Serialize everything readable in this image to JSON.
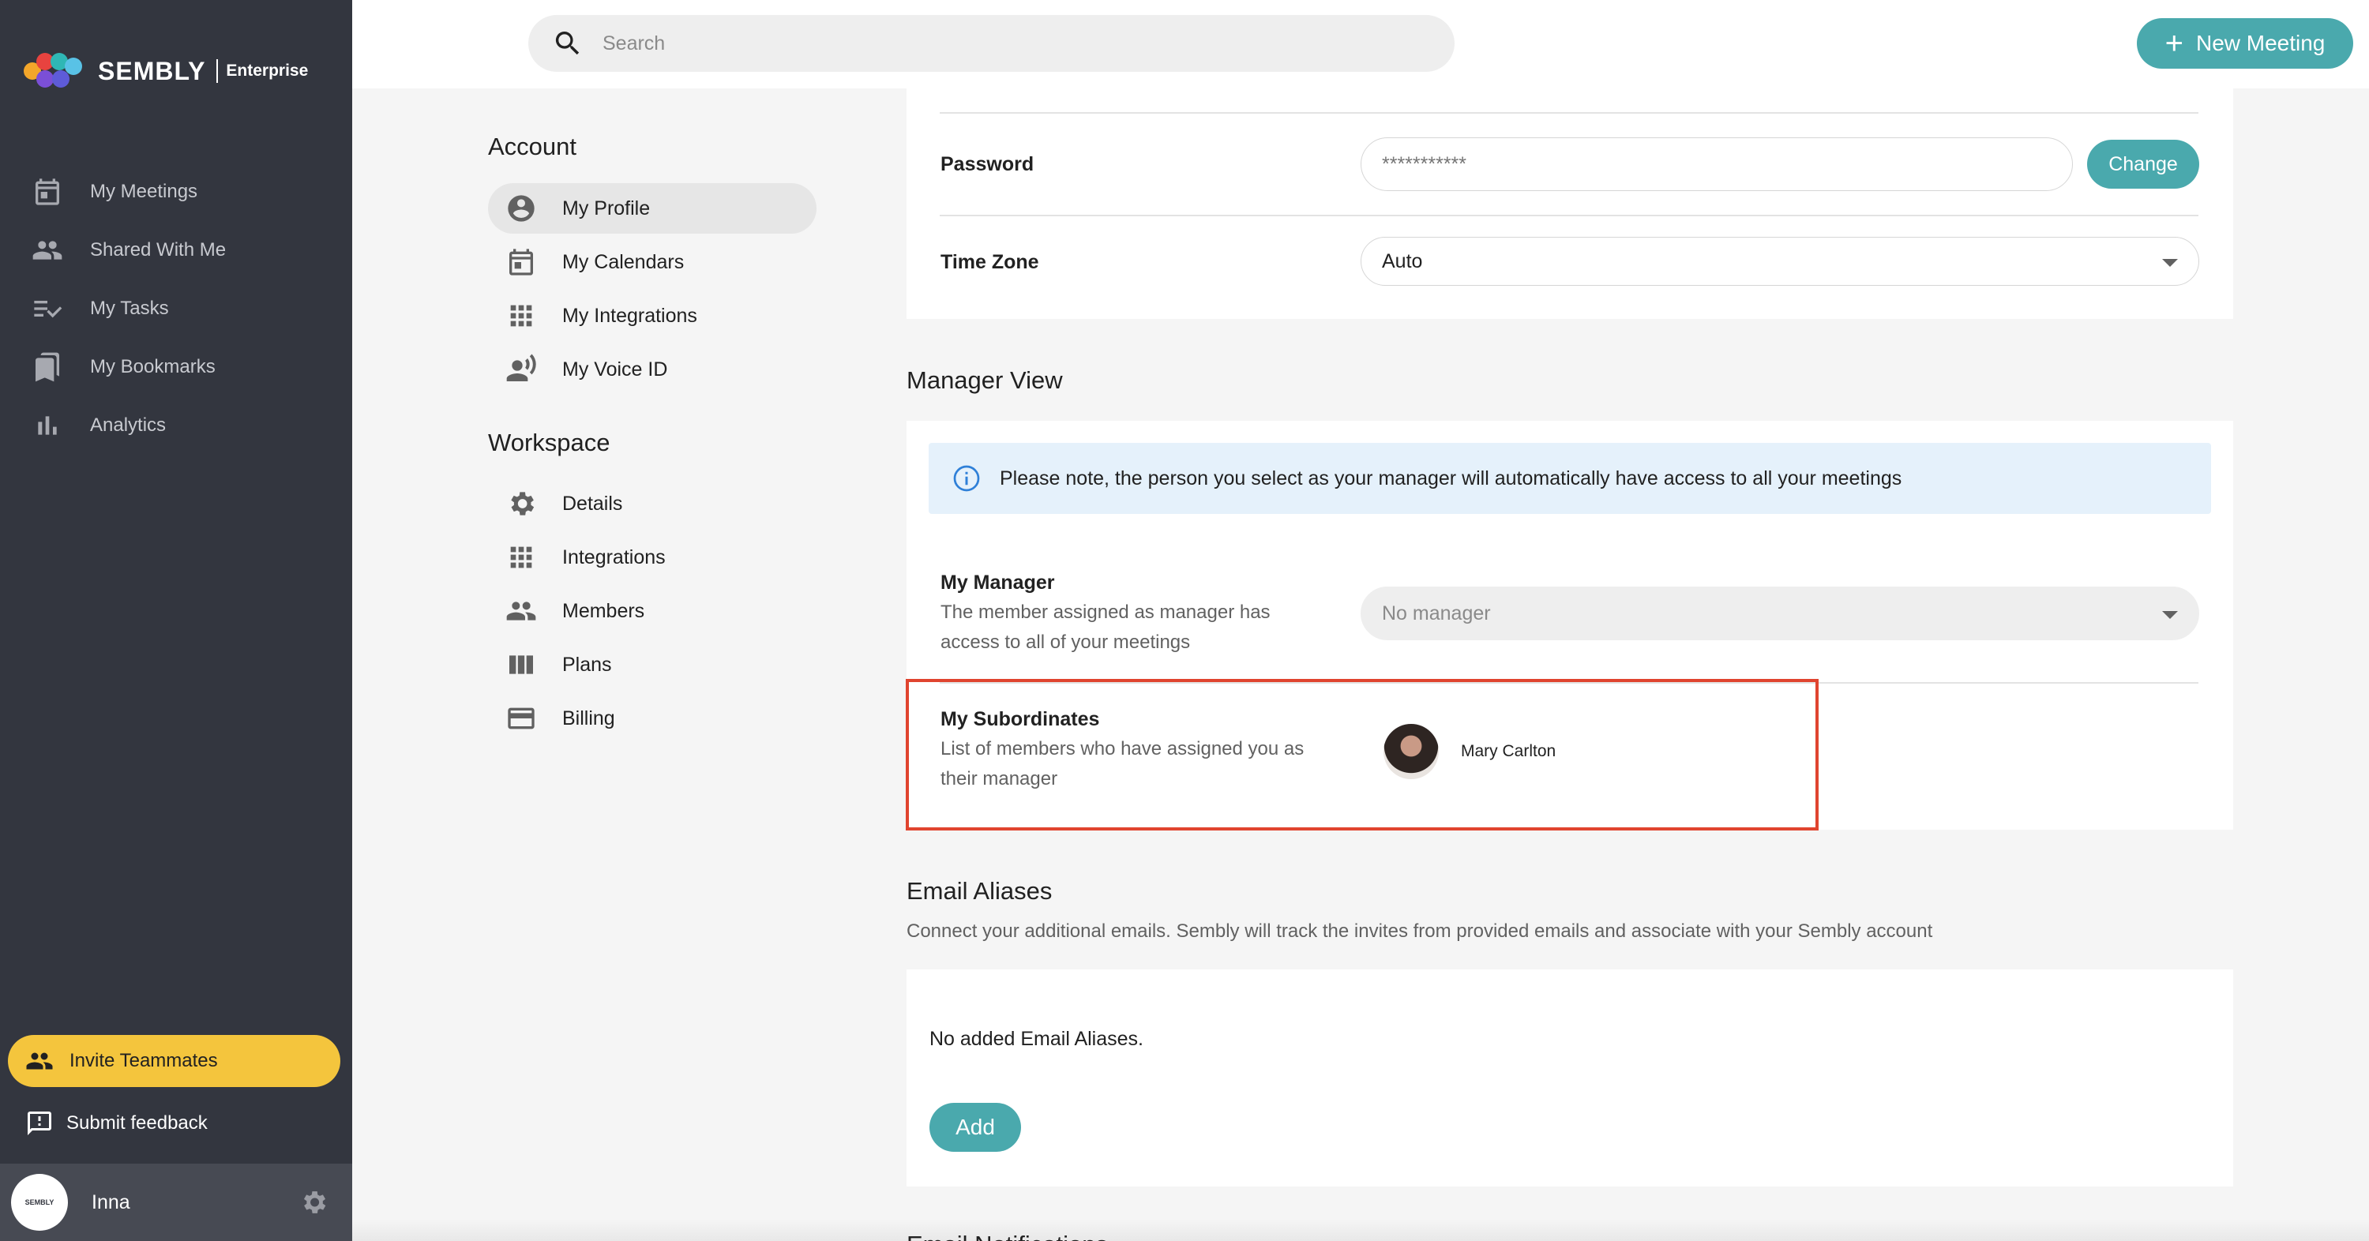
{
  "brand": {
    "name": "SEMBLY",
    "edition": "Enterprise"
  },
  "sidebar": {
    "items": [
      {
        "label": "My Meetings",
        "icon": "calendar-icon"
      },
      {
        "label": "Shared With Me",
        "icon": "people-icon"
      },
      {
        "label": "My Tasks",
        "icon": "tasks-icon"
      },
      {
        "label": "My Bookmarks",
        "icon": "bookmark-icon"
      },
      {
        "label": "Analytics",
        "icon": "bar-chart-icon"
      }
    ],
    "invite_label": "Invite Teammates",
    "feedback_label": "Submit feedback",
    "user_name": "Inna",
    "user_avatar_text": "SEMBLY"
  },
  "topbar": {
    "search_placeholder": "Search",
    "new_meeting_label": "New Meeting"
  },
  "settings_nav": {
    "account_title": "Account",
    "account_items": [
      "My Profile",
      "My Calendars",
      "My Integrations",
      "My Voice ID"
    ],
    "workspace_title": "Workspace",
    "workspace_items": [
      "Details",
      "Integrations",
      "Members",
      "Plans",
      "Billing"
    ]
  },
  "profile": {
    "password_label": "Password",
    "password_value": "***********",
    "change_label": "Change",
    "timezone_label": "Time Zone",
    "timezone_value": "Auto"
  },
  "manager_view": {
    "title": "Manager View",
    "info": "Please note, the person you select as your manager will automatically have access to all your meetings",
    "manager_label": "My Manager",
    "manager_desc": "The member assigned as manager has access to all of your meetings",
    "manager_value": "No manager",
    "subordinates_label": "My Subordinates",
    "subordinates_desc": "List of members who have assigned you as their manager",
    "subordinates": [
      "Mary Carlton"
    ]
  },
  "email_aliases": {
    "title": "Email Aliases",
    "desc": "Connect your additional emails. Sembly will track the invites from provided emails and associate with your Sembly account",
    "empty": "No added Email Aliases.",
    "add_label": "Add"
  },
  "next_section_title": "Email Notifications",
  "colors": {
    "accent": "#4aa9ad",
    "sidebar": "#33363f",
    "invite": "#f4c53d",
    "highlight": "#e0442f"
  }
}
